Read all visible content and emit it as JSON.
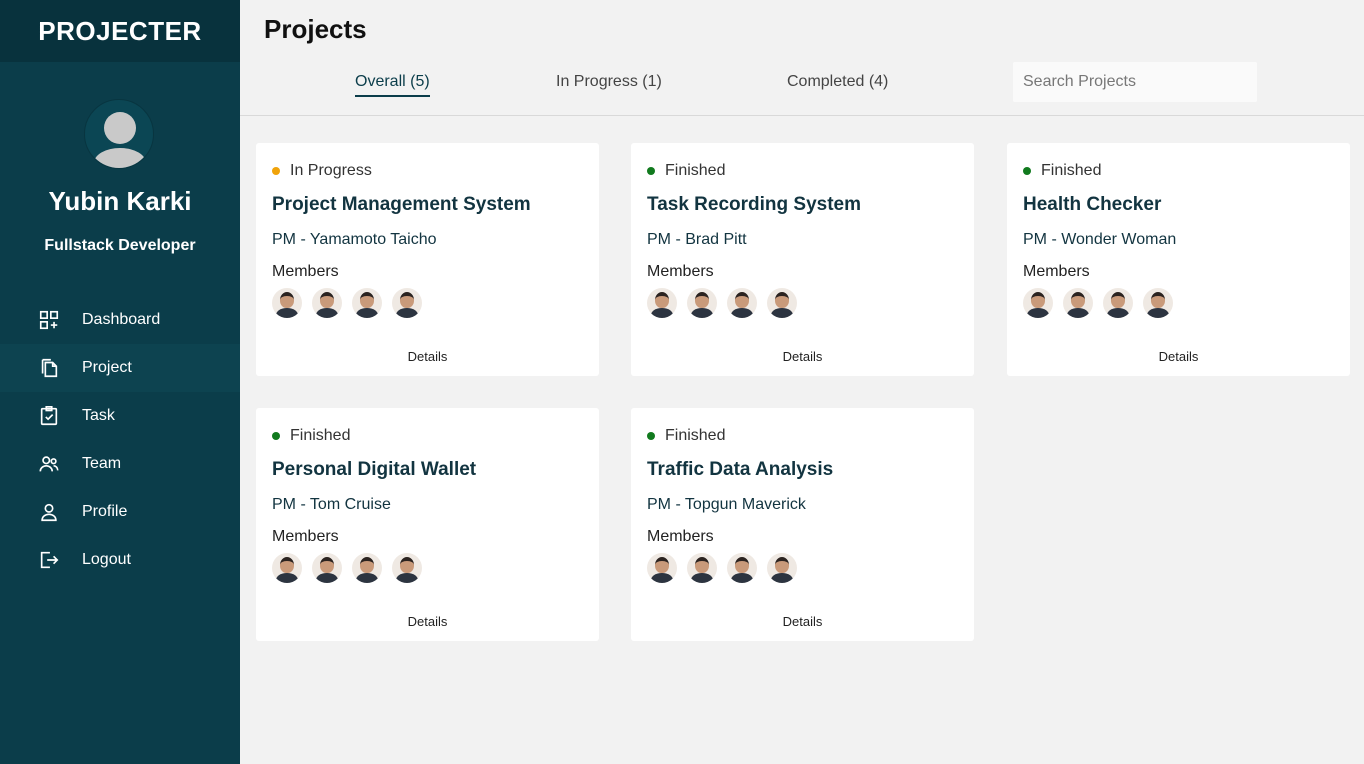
{
  "app": {
    "brand": "PROJECTER"
  },
  "user": {
    "name": "Yubin Karki",
    "role": "Fullstack Developer"
  },
  "nav": [
    {
      "label": "Dashboard",
      "icon": "dashboard-icon"
    },
    {
      "label": "Project",
      "icon": "document-icon"
    },
    {
      "label": "Task",
      "icon": "clipboard-check-icon"
    },
    {
      "label": "Team",
      "icon": "team-icon"
    },
    {
      "label": "Profile",
      "icon": "user-icon"
    },
    {
      "label": "Logout",
      "icon": "logout-icon"
    }
  ],
  "header": {
    "title": "Projects"
  },
  "tabs": [
    {
      "label": "Overall (5)"
    },
    {
      "label": "In Progress (1)"
    },
    {
      "label": "Completed (4)"
    }
  ],
  "search": {
    "placeholder": "Search Projects",
    "value": ""
  },
  "colors": {
    "in_progress": "#f0a30a",
    "finished": "#117a1e",
    "sidebar": "#0b3d4a"
  },
  "projects": [
    {
      "status": "In Progress",
      "title": "Project Management System",
      "pm": "PM - Yamamoto Taicho",
      "members_label": "Members",
      "details_label": "Details"
    },
    {
      "status": "Finished",
      "title": "Task Recording System",
      "pm": "PM - Brad Pitt",
      "members_label": "Members",
      "details_label": "Details"
    },
    {
      "status": "Finished",
      "title": "Health Checker",
      "pm": "PM - Wonder Woman",
      "members_label": "Members",
      "details_label": "Details"
    },
    {
      "status": "Finished",
      "title": "Personal Digital Wallet",
      "pm": "PM - Tom Cruise",
      "members_label": "Members",
      "details_label": "Details"
    },
    {
      "status": "Finished",
      "title": "Traffic Data Analysis",
      "pm": "PM - Topgun Maverick",
      "members_label": "Members",
      "details_label": "Details"
    }
  ]
}
